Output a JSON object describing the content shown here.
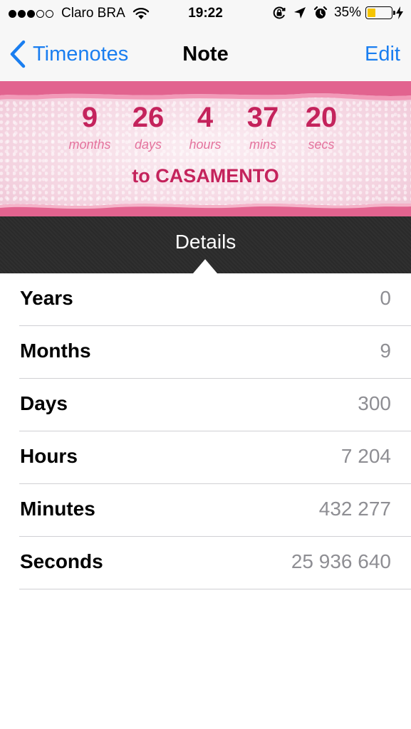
{
  "status_bar": {
    "signal_filled": 3,
    "signal_total": 5,
    "carrier": "Claro BRA",
    "time": "19:22",
    "battery_percent": "35%",
    "battery_level": 0.35,
    "battery_color": "#f5c400",
    "icons": [
      "wifi-icon",
      "orientation-lock-icon",
      "location-arrow-icon",
      "alarm-icon",
      "charging-bolt-icon"
    ]
  },
  "nav": {
    "back_label": "Timenotes",
    "title": "Note",
    "edit_label": "Edit",
    "accent_color": "#1a7ef0"
  },
  "countdown": {
    "units": [
      {
        "value": "9",
        "label": "months"
      },
      {
        "value": "26",
        "label": "days"
      },
      {
        "value": "4",
        "label": "hours"
      },
      {
        "value": "37",
        "label": "mins"
      },
      {
        "value": "20",
        "label": "secs"
      }
    ],
    "target": "to CASAMENTO",
    "value_color": "#c4235c",
    "label_color": "#e4739d"
  },
  "details": {
    "title": "Details",
    "rows": [
      {
        "label": "Years",
        "value": "0"
      },
      {
        "label": "Months",
        "value": "9"
      },
      {
        "label": "Days",
        "value": "300"
      },
      {
        "label": "Hours",
        "value": "7 204"
      },
      {
        "label": "Minutes",
        "value": "432 277"
      },
      {
        "label": "Seconds",
        "value": "25 936 640"
      }
    ]
  }
}
